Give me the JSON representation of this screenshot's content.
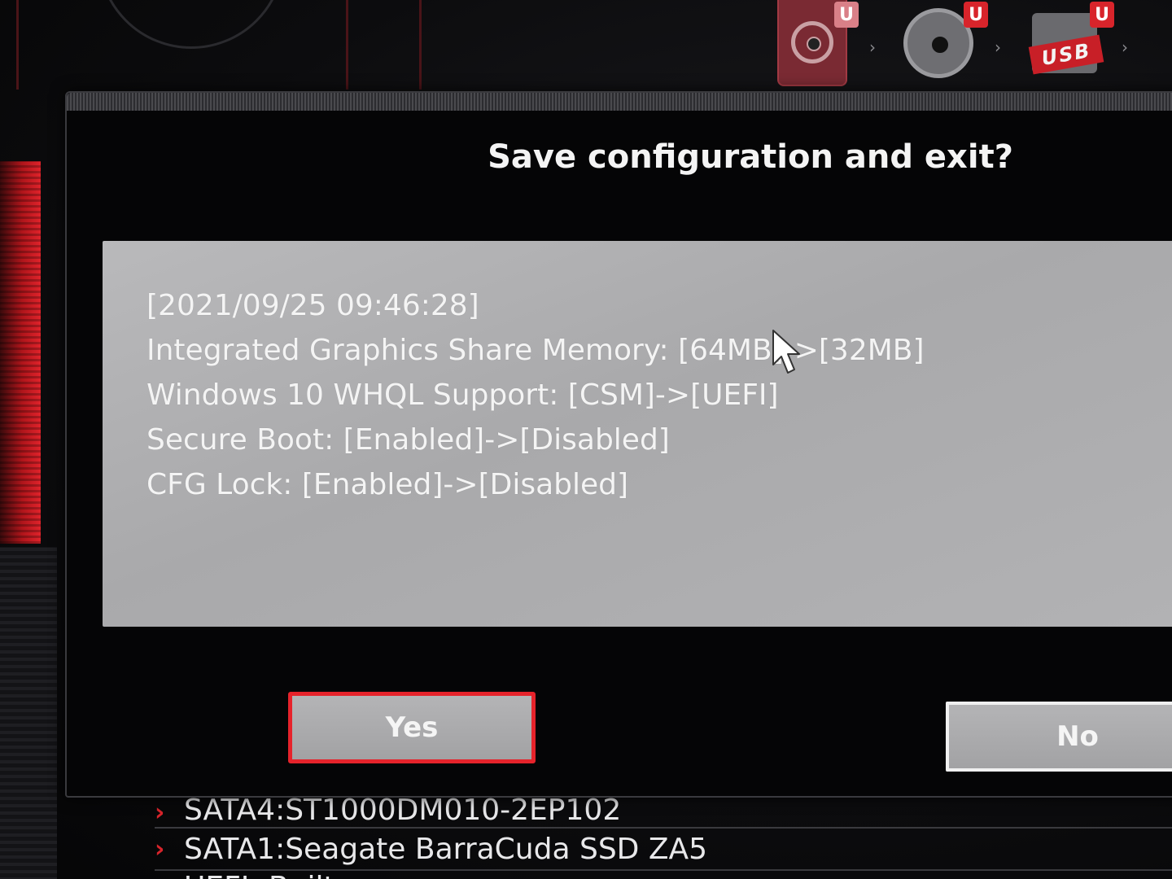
{
  "dialog": {
    "title": "Save configuration and exit?",
    "changes": [
      "[2021/09/25 09:46:28]",
      "Integrated Graphics Share Memory: [64MB]->[32MB]",
      "Windows 10 WHQL Support: [CSM]->[UEFI]",
      "Secure Boot: [Enabled]->[Disabled]",
      "CFG Lock: [Enabled]->[Disabled]"
    ],
    "yes_label": "Yes",
    "no_label": "No"
  },
  "boot_priority": {
    "badge": "U",
    "usb_label": "USB",
    "arrow": "›",
    "devices": [
      "hdd-icon",
      "optical-disc-icon",
      "usb-drive-icon"
    ]
  },
  "boot_list": [
    {
      "chevron": "›",
      "label": "SATA4:ST1000DM010-2EP102"
    },
    {
      "chevron": "›",
      "label": "SATA1:Seagate BarraCuda SSD ZA5"
    },
    {
      "chevron": "›",
      "label": "UEFI: Built"
    }
  ],
  "colors": {
    "accent": "#d8242b",
    "panel": "#b0b0b2",
    "background": "#0b0b0d"
  }
}
